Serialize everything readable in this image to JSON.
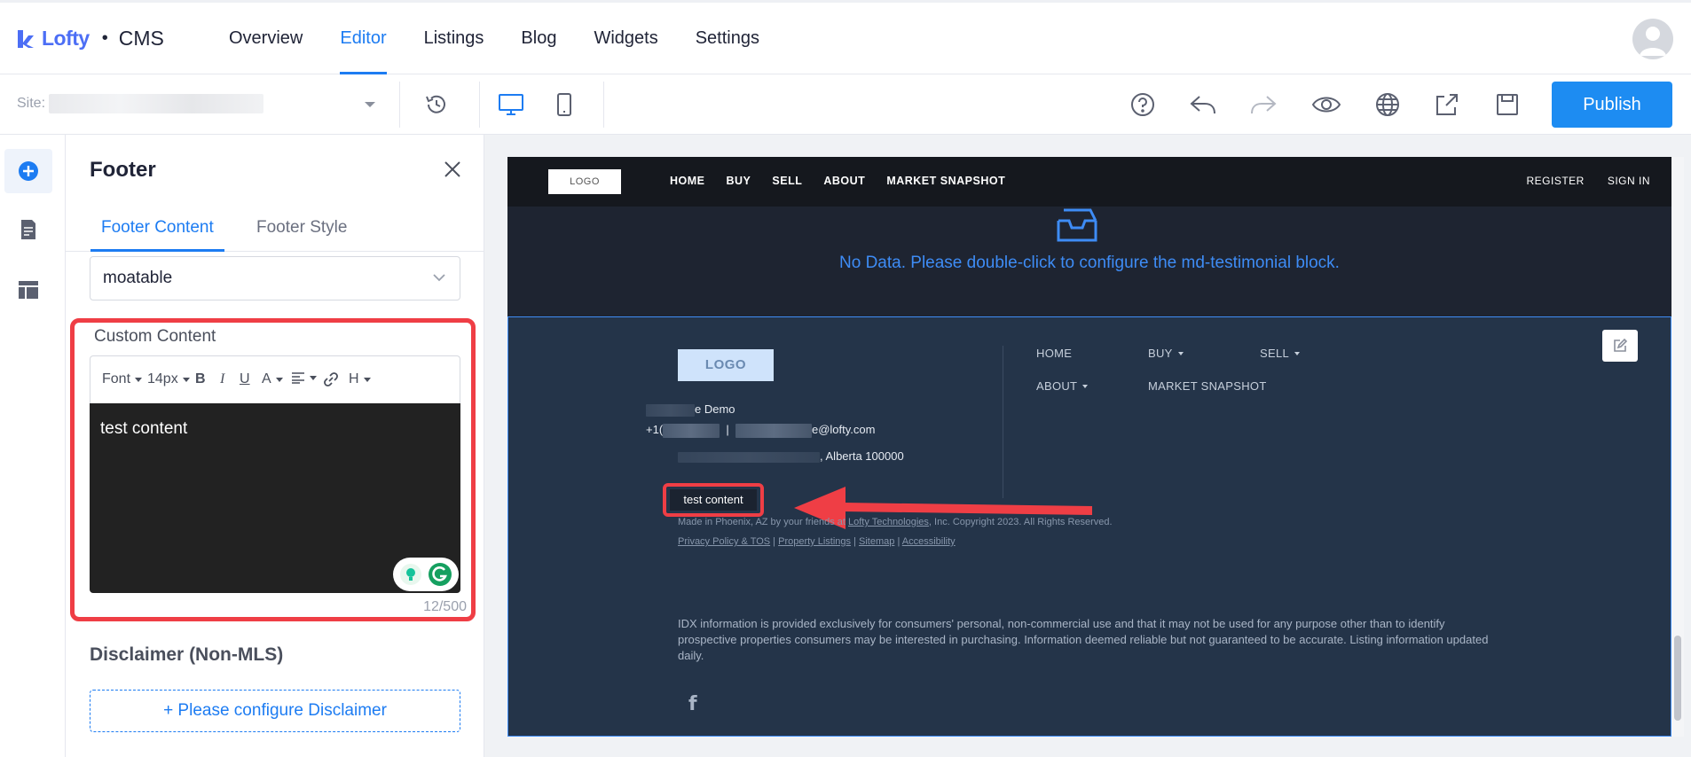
{
  "brand": {
    "name": "Lofty",
    "product": "CMS"
  },
  "nav": {
    "items": [
      "Overview",
      "Editor",
      "Listings",
      "Blog",
      "Widgets",
      "Settings"
    ],
    "active": "Editor"
  },
  "toolbar": {
    "site_label": "Site:",
    "publish_label": "Publish"
  },
  "panel": {
    "title": "Footer",
    "tabs": [
      "Footer Content",
      "Footer Style"
    ],
    "active_tab": "Footer Content",
    "select_value": "moatable",
    "custom_content_label": "Custom Content",
    "editor_toolbar": {
      "font": "Font",
      "size": "14px",
      "bold": "B",
      "italic": "I",
      "underline": "U",
      "color": "A",
      "heading": "H"
    },
    "editor_text": "test content",
    "counter": "12/500",
    "disclaimer_title": "Disclaimer (Non-MLS)",
    "disclaimer_button": "+ Please configure Disclaimer"
  },
  "preview": {
    "logo": "LOGO",
    "header_nav": [
      "HOME",
      "BUY",
      "SELL",
      "ABOUT",
      "MARKET SNAPSHOT"
    ],
    "header_right": [
      "REGISTER",
      "SIGN IN"
    ],
    "no_data": "No Data. Please double-click to configure the md-testimonial block.",
    "footer": {
      "logo": "LOGO",
      "links": [
        "HOME",
        "BUY",
        "SELL",
        "ABOUT",
        "MARKET SNAPSHOT"
      ],
      "name_suffix": "e Demo",
      "phone_prefix": "+1(",
      "email_suffix": "e@lofty.com",
      "address_suffix": ", Alberta 100000",
      "custom_text": "test content",
      "made_in_prefix": "Made in Phoenix, AZ by your friends at",
      "made_in_link": "Lofty Technologies",
      "made_in_suffix": ", Inc. Copyright 2023. All Rights Reserved.",
      "legal_links": [
        "Privacy Policy & TOS",
        "Property Listings",
        "Sitemap",
        "Accessibility"
      ],
      "idx": "IDX information is provided exclusively for consumers' personal, non-commercial use and that it may not be used for any purpose other than to identify prospective properties consumers may be interested in purchasing. Information deemed reliable but not guaranteed to be accurate. Listing information updated daily.",
      "social": "f"
    }
  },
  "colors": {
    "accent": "#1d7cf2",
    "highlight": "#ef3e45",
    "footer_bg": "#243449"
  }
}
